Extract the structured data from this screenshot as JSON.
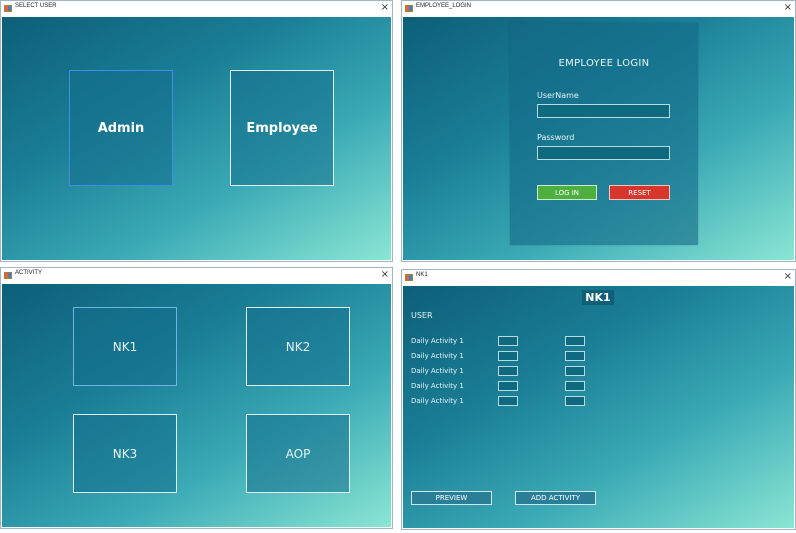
{
  "select_user": {
    "title": "SELECT USER",
    "close": "×",
    "admin_label": "Admin",
    "employee_label": "Employee"
  },
  "employee_login": {
    "title": "EMPLOYEE_LOGIN",
    "close": "×",
    "heading": "EMPLOYEE LOGIN",
    "username_label": "UserName",
    "username_value": "",
    "password_label": "Password",
    "password_value": "",
    "login_label": "LOG IN",
    "reset_label": "RESET",
    "colors": {
      "login": "#4caf3e",
      "reset": "#d6362c"
    }
  },
  "activity": {
    "title": "ACTIVITY",
    "close": "×",
    "tiles": [
      "NK1",
      "NK2",
      "NK3",
      "AOP"
    ]
  },
  "nk1": {
    "title": "NK1",
    "close": "×",
    "heading": "NK1",
    "user_label": "USER",
    "rows": [
      {
        "label": "Daily Activity 1"
      },
      {
        "label": "Daily Activity 1"
      },
      {
        "label": "Daily Activity 1"
      },
      {
        "label": "Daily Activity 1"
      },
      {
        "label": "Daily Activity 1"
      }
    ],
    "preview_label": "PREVIEW",
    "add_activity_label": "ADD ACTIVITY"
  }
}
